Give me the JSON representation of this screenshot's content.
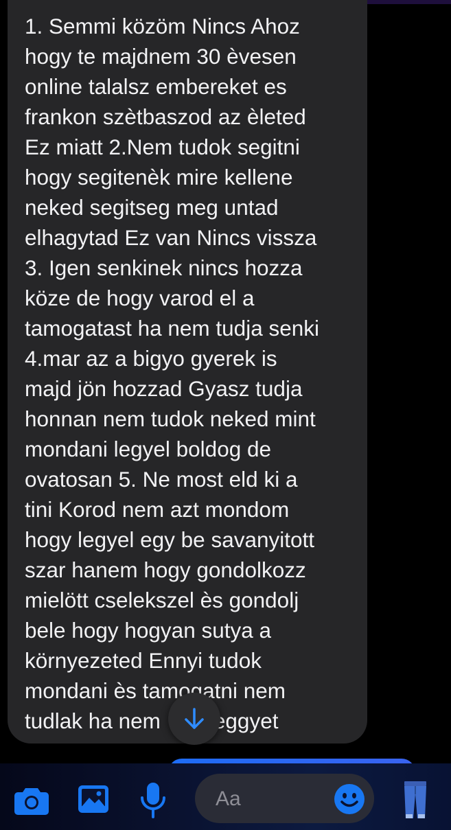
{
  "conversation": {
    "incoming_message": {
      "lines": [
        "1. Semmi közöm Nincs Ahoz",
        "hogy te majdnem 30 èvesen",
        "online talalsz embereket es",
        "frankon szètbaszod az èleted",
        "Ez miatt 2.Nem tudok segitni",
        "hogy segitenèk mire kellene",
        "neked segitseg meg untad",
        "elhagytad Ez van Nincs vissza",
        "3. Igen senkinek nincs hozza",
        "köze de hogy varod el a",
        "tamogatast ha nem tudja senki",
        "4.mar az a bigyo gyerek is",
        "majd jön hozzad Gyasz tudja",
        "honnan nem tudok neked mint",
        "mondani legyel boldog de",
        "ovatosan 5. Ne most eld ki a",
        "tini Korod nem azt mondom",
        "hogy legyel egy be savanyitott",
        "szar hanem hogy gondolkozz",
        "mielött cselekszel ès gondolj",
        "bele hogy hogyan sutya a",
        "környezeted Ennyi tudok",
        "mondani ès tamogatni nem",
        "tudlak ha nem      k eggyet"
      ]
    },
    "scroll_down_icon": "arrow-down-icon"
  },
  "composer": {
    "input_placeholder": "Aa",
    "camera_icon": "camera-icon",
    "gallery_icon": "image-icon",
    "mic_icon": "microphone-icon",
    "emoji_icon": "smiley-icon",
    "quick_reaction_icon": "jeans-icon"
  },
  "colors": {
    "accent": "#1877f2",
    "bubble": "#262628",
    "text": "#f2f2f4"
  }
}
